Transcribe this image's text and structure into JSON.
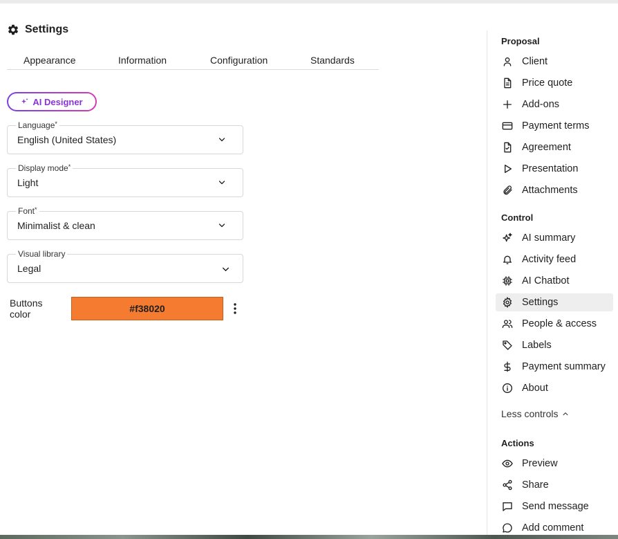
{
  "settings": {
    "title": "Settings",
    "icon": "gear-icon",
    "tabs": [
      {
        "label": "Appearance"
      },
      {
        "label": "Information"
      },
      {
        "label": "Configuration"
      },
      {
        "label": "Standards"
      }
    ],
    "ai_designer_label": "AI Designer",
    "fields": {
      "language": {
        "label": "Language",
        "required": "*",
        "value": "English (United States)"
      },
      "display_mode": {
        "label": "Display mode",
        "required": "*",
        "value": "Light"
      },
      "font": {
        "label": "Font",
        "required": "*",
        "value": "Minimalist & clean"
      },
      "visual_library": {
        "label": "Visual library",
        "value": "Legal"
      }
    },
    "buttons_color": {
      "label_line1": "Buttons",
      "label_line2": "color",
      "value": "#f38020",
      "swatch_color": "#f47b30"
    }
  },
  "sidebar": {
    "proposal": {
      "title": "Proposal",
      "items": [
        {
          "label": "Client",
          "icon": "person-icon"
        },
        {
          "label": "Price quote",
          "icon": "document-icon"
        },
        {
          "label": "Add-ons",
          "icon": "plus-icon"
        },
        {
          "label": "Payment terms",
          "icon": "credit-card-icon"
        },
        {
          "label": "Agreement",
          "icon": "signed-document-icon"
        },
        {
          "label": "Presentation",
          "icon": "play-icon"
        },
        {
          "label": "Attachments",
          "icon": "paperclip-icon"
        }
      ]
    },
    "control": {
      "title": "Control",
      "items": [
        {
          "label": "AI summary",
          "icon": "sparkles-icon"
        },
        {
          "label": "Activity feed",
          "icon": "bell-icon"
        },
        {
          "label": "AI Chatbot",
          "icon": "chip-icon"
        },
        {
          "label": "Settings",
          "icon": "gear-icon",
          "active": true
        },
        {
          "label": "People & access",
          "icon": "people-icon"
        },
        {
          "label": "Labels",
          "icon": "tag-icon"
        },
        {
          "label": "Payment summary",
          "icon": "dollar-icon"
        },
        {
          "label": "About",
          "icon": "info-icon"
        }
      ],
      "less_controls": "Less controls"
    },
    "actions": {
      "title": "Actions",
      "items": [
        {
          "label": "Preview",
          "icon": "eye-icon"
        },
        {
          "label": "Share",
          "icon": "share-icon"
        },
        {
          "label": "Send message",
          "icon": "message-icon"
        },
        {
          "label": "Add comment",
          "icon": "comment-icon"
        }
      ]
    }
  },
  "colors": {
    "accent_gradient_start": "#7b3fe4",
    "accent_gradient_end": "#d33bb7",
    "active_item_bg": "#eeeeee"
  }
}
